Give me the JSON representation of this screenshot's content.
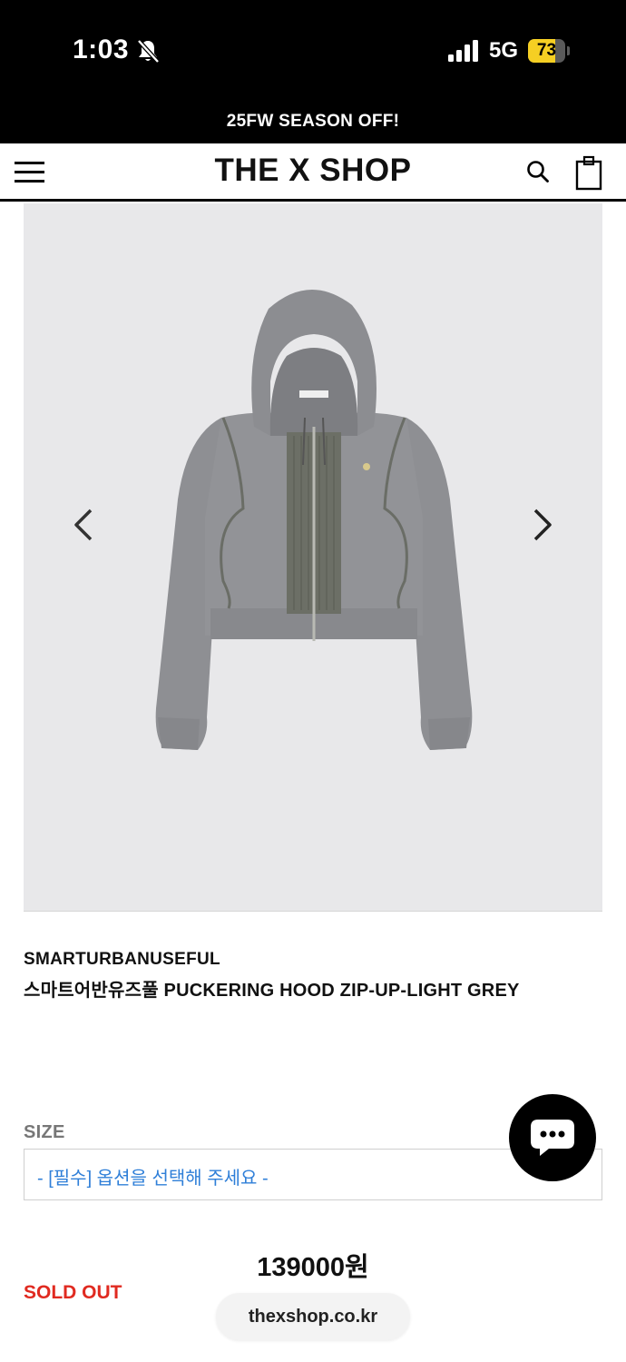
{
  "status_bar": {
    "time": "1:03",
    "network": "5G",
    "battery_level": "73",
    "battery_fraction": 0.73,
    "accent_color": "#f5cf23",
    "icons": [
      "bell-slash-icon",
      "cellular-signal-icon",
      "battery-icon"
    ]
  },
  "promo": {
    "text": "25FW SEASON OFF!"
  },
  "header": {
    "logo": "THE X SHOP",
    "icons": [
      "menu-icon",
      "search-icon",
      "shopping-bag-icon"
    ]
  },
  "gallery": {
    "icons": [
      "chevron-left-icon",
      "chevron-right-icon"
    ],
    "image_subject": "light grey cropped hooded zip-up jacket"
  },
  "product": {
    "brand": "SMARTURBANUSEFUL",
    "title": "스마트어반유즈풀 PUCKERING HOOD ZIP-UP-LIGHT GREY",
    "size_label": "SIZE",
    "size_placeholder": "- [필수] 옵션을 선택해 주세요 -",
    "price": "139000원",
    "status": "SOLD OUT",
    "status_color": "#e02a20",
    "option_color": "#2f7fd8"
  },
  "chat": {
    "icon": "chat-bubble-icon"
  },
  "browser": {
    "url": "thexshop.co.kr"
  }
}
